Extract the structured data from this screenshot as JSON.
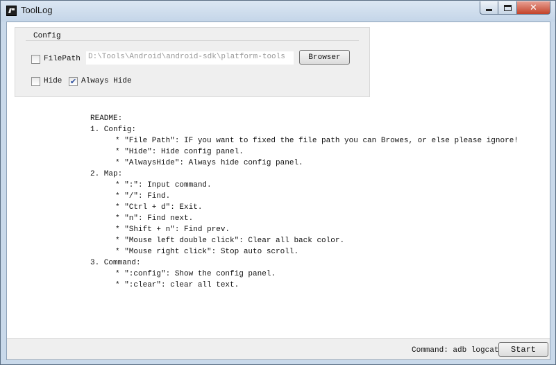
{
  "window": {
    "title": "ToolLog",
    "close_glyph": "✕"
  },
  "config": {
    "legend": "Config",
    "filepath_label": "FilePath",
    "filepath_checked": false,
    "filepath_value": "D:\\Tools\\Android\\android-sdk\\platform-tools",
    "browser_label": "Browser",
    "hide_label": "Hide",
    "hide_checked": false,
    "always_hide_label": "Always Hide",
    "always_hide_checked": true,
    "check_glyph": "✔"
  },
  "readme": {
    "lines": [
      {
        "text": "README:",
        "indent": false
      },
      {
        "text": "1. Config:",
        "indent": false
      },
      {
        "text": "* \"File Path\": IF you want to fixed the file path you can Browes, or else please ignore!",
        "indent": true
      },
      {
        "text": "* \"Hide\": Hide config panel.",
        "indent": true
      },
      {
        "text": "* \"AlwaysHide\": Always hide config panel.",
        "indent": true
      },
      {
        "text": "2. Map:",
        "indent": false
      },
      {
        "text": "* \":\": Input command.",
        "indent": true
      },
      {
        "text": "* \"/\": Find.",
        "indent": true
      },
      {
        "text": "* \"Ctrl + d\": Exit.",
        "indent": true
      },
      {
        "text": "* \"n\": Find next.",
        "indent": true
      },
      {
        "text": "* \"Shift + n\": Find prev.",
        "indent": true
      },
      {
        "text": "* \"Mouse left double click\": Clear all back color.",
        "indent": true
      },
      {
        "text": "* \"Mouse right click\": Stop auto scroll.",
        "indent": true
      },
      {
        "text": "3. Command:",
        "indent": false
      },
      {
        "text": "* \":config\": Show the config panel.",
        "indent": true
      },
      {
        "text": "* \":clear\": clear all text.",
        "indent": true
      }
    ]
  },
  "statusbar": {
    "command_text": "Command: adb logcat",
    "start_label": "Start"
  }
}
